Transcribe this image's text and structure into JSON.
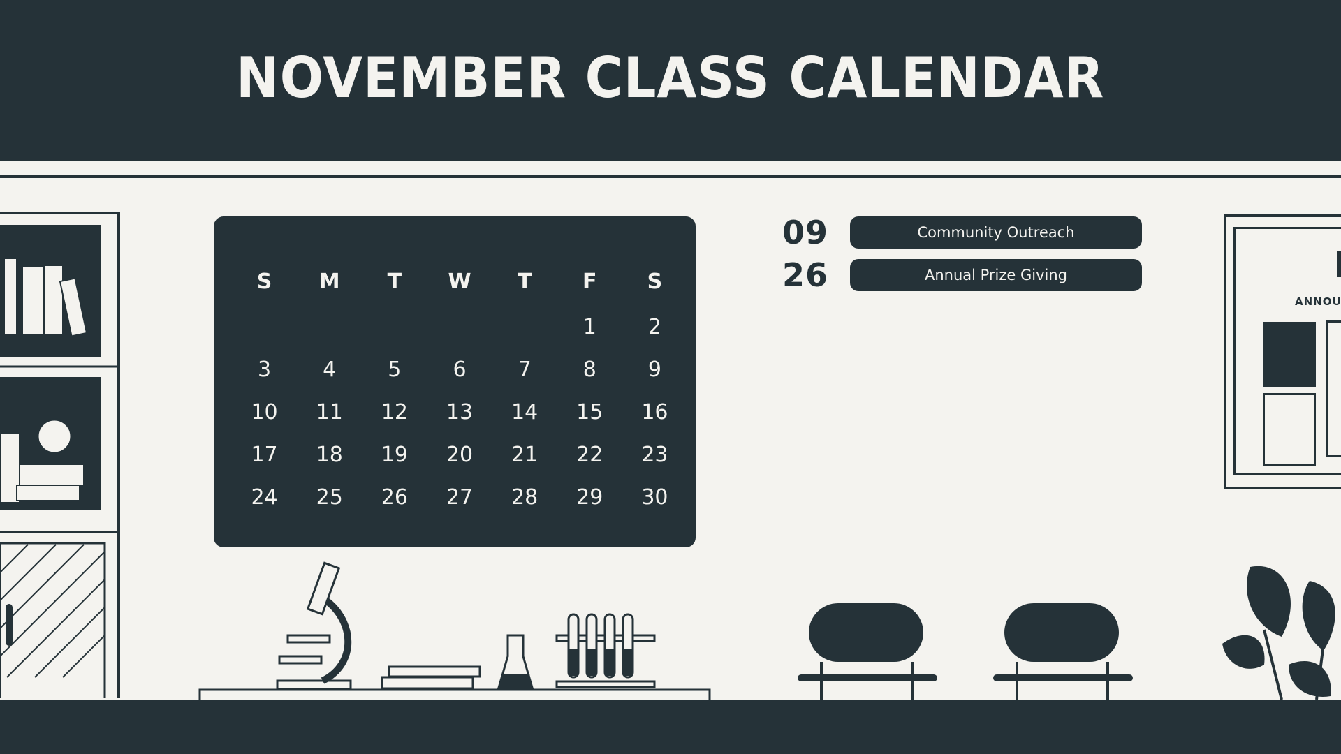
{
  "header": {
    "title": "NOVEMBER CLASS CALENDAR"
  },
  "calendar": {
    "days_of_week": [
      "S",
      "M",
      "T",
      "W",
      "T",
      "F",
      "S"
    ],
    "weeks": [
      [
        "",
        "",
        "",
        "",
        "",
        "1",
        "2"
      ],
      [
        "3",
        "4",
        "5",
        "6",
        "7",
        "8",
        "9"
      ],
      [
        "10",
        "11",
        "12",
        "13",
        "14",
        "15",
        "16"
      ],
      [
        "17",
        "18",
        "19",
        "20",
        "21",
        "22",
        "23"
      ],
      [
        "24",
        "25",
        "26",
        "27",
        "28",
        "29",
        "30"
      ]
    ]
  },
  "events": [
    {
      "date": "09",
      "label": "Community Outreach"
    },
    {
      "date": "26",
      "label": "Annual Prize Giving"
    }
  ],
  "board": {
    "heading": "ANNOUN"
  },
  "colors": {
    "dark": "#253238",
    "light": "#f4f3ef"
  },
  "icons": [
    "bookshelf-icon",
    "globe-icon",
    "microscope-icon",
    "flask-icon",
    "test-tubes-icon",
    "books-icon",
    "chair-icon",
    "bulletin-board-icon",
    "plant-icon"
  ]
}
